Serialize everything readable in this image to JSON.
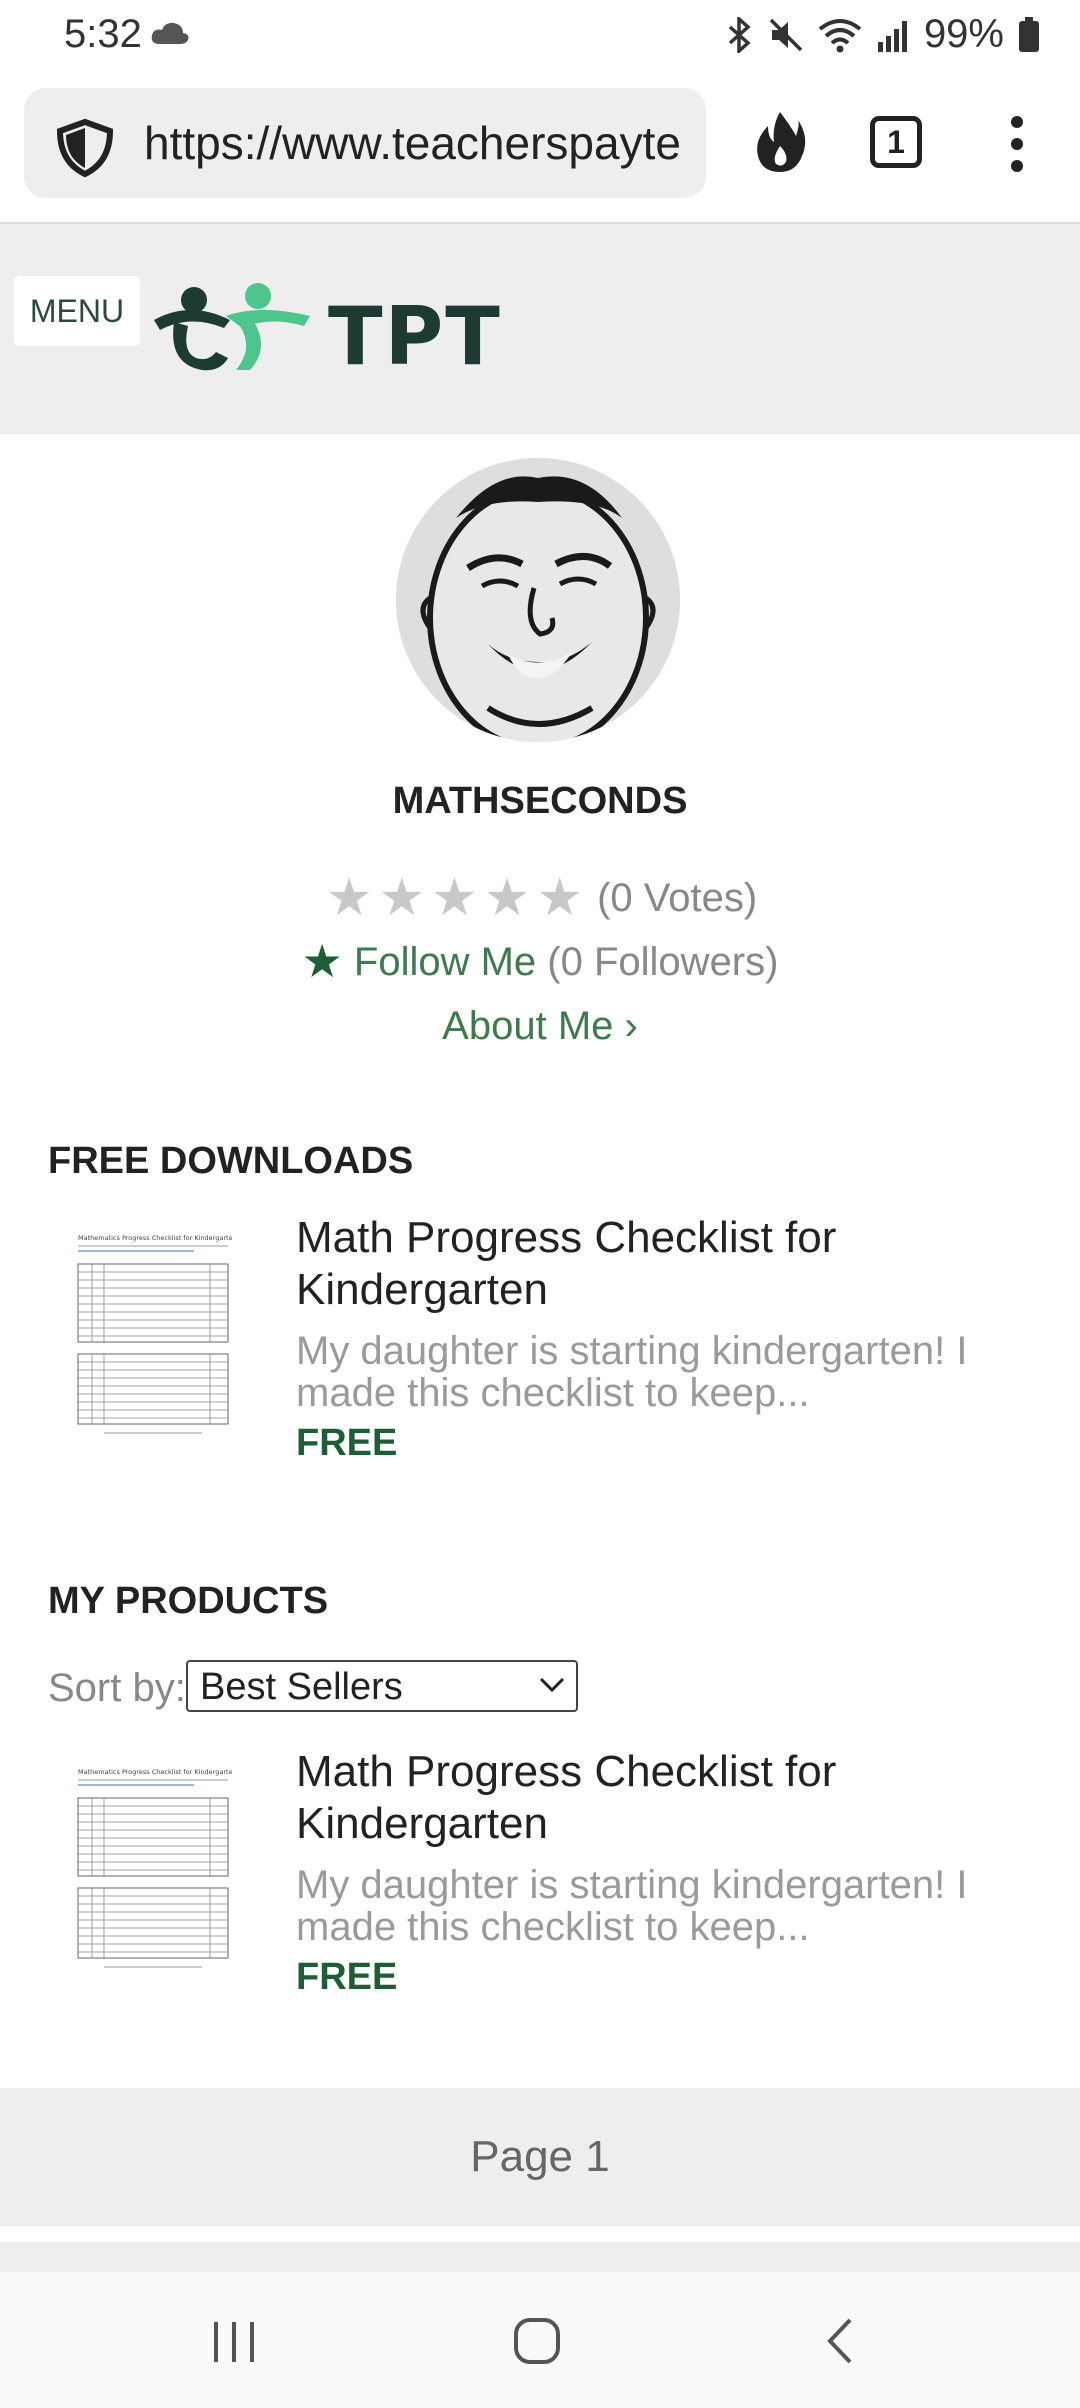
{
  "status_bar": {
    "time": "5:32",
    "battery": "99%"
  },
  "browser": {
    "url": "https://www.teacherspayte",
    "tab_count": "1"
  },
  "site": {
    "menu_label": "MENU",
    "logo_text": "TPT"
  },
  "profile": {
    "store_name": "MATHSECONDS",
    "votes": "(0 Votes)",
    "rating_stars": 0,
    "follow_label": "Follow Me",
    "followers": "(0 Followers)",
    "about": "About Me ›"
  },
  "free_downloads": {
    "heading": "FREE DOWNLOADS",
    "item": {
      "title": "Math Progress Checklist for Kindergarten",
      "desc": "My daughter is starting kindergarten! I made this checklist to keep...",
      "price": "FREE",
      "thumb_title": "Mathematics Progress Checklist for Kindergarten"
    }
  },
  "my_products": {
    "heading": "MY PRODUCTS",
    "sort_label": "Sort by:",
    "sort_value": "Best Sellers",
    "item": {
      "title": "Math Progress Checklist for Kindergarten",
      "desc": "My daughter is starting kindergarten! I made this checklist to keep...",
      "price": "FREE",
      "thumb_title": "Mathematics Progress Checklist for Kindergarten"
    }
  },
  "pager": {
    "label": "Page 1"
  },
  "colors": {
    "brand_green": "#1e5e35",
    "link_green": "#3d7a4e",
    "logo_light_green": "#4cc68a"
  }
}
